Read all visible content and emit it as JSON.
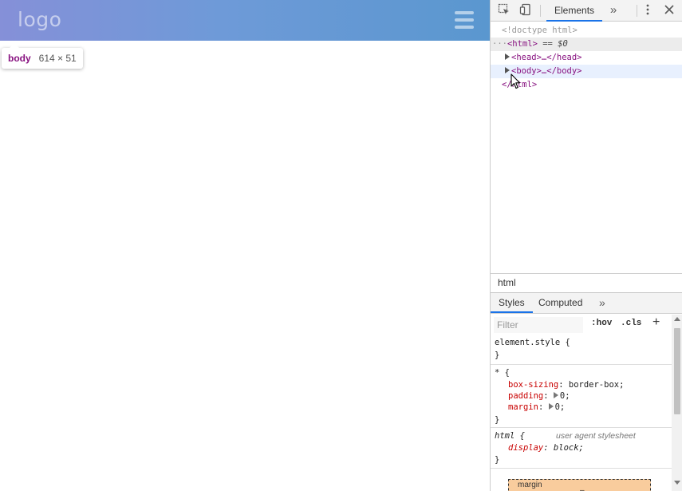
{
  "page": {
    "logo_text": "logo",
    "hamburger_icon": "hamburger-menu-icon",
    "header_gradient": [
      "#8590d8",
      "#5a97cf"
    ]
  },
  "tooltip": {
    "tag": "body",
    "dimensions": "614 × 51"
  },
  "devtools": {
    "toolbar": {
      "elements_tab": "Elements",
      "inspect_icon": "inspect-element-icon",
      "device_icon": "device-toolbar-icon",
      "more_tabs_icon": "chevron-double-right-icon",
      "menu_icon": "kebab-menu-icon",
      "close_icon": "close-icon"
    },
    "dom": {
      "doctype": "<!doctype html>",
      "html_open": "<html>",
      "html_suffix": "== $0",
      "head_line": "<head>…</head>",
      "body_line": "<body>…</body>",
      "html_close": "</html>"
    },
    "breadcrumb": "html",
    "style_tabs": {
      "styles": "Styles",
      "computed": "Computed"
    },
    "filter": {
      "placeholder": "Filter",
      "hov": ":hov",
      "cls": ".cls",
      "plus": "+"
    },
    "rules": {
      "element_style": "element.style {",
      "close_brace": "}",
      "star_selector": "* {",
      "box_sizing_prop": "box-sizing",
      "box_sizing_val": "border-box;",
      "padding_prop": "padding",
      "padding_val": "0;",
      "margin_prop": "margin",
      "margin_val": "0;",
      "html_selector": "html {",
      "ua_label": "user agent stylesheet",
      "display_prop": "display",
      "display_val": "block;"
    },
    "box_model": {
      "label": "margin",
      "value": "–"
    }
  }
}
